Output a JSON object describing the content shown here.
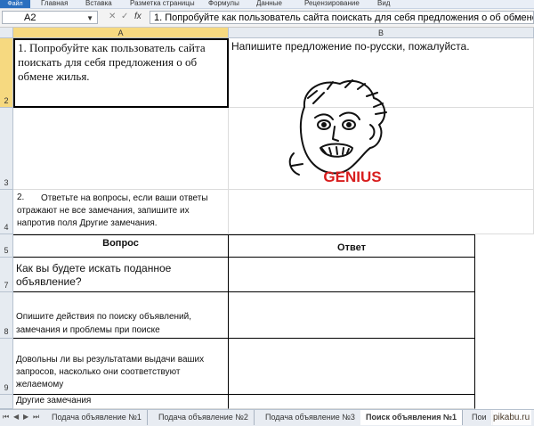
{
  "ribbon": {
    "file": "Файл",
    "tabs": [
      "Главная",
      "Вставка",
      "Разметка страницы",
      "Формулы",
      "Данные",
      "Рецензирование",
      "Вид"
    ]
  },
  "formula_bar": {
    "name_box": "A2",
    "fx": "fx",
    "value": "1. Попробуйте как пользователь сайта поискать для себя предложения о об обмене жилья."
  },
  "columns": [
    "A",
    "B"
  ],
  "rows": [
    "2",
    "3",
    "4",
    "5",
    "7",
    "8",
    "9"
  ],
  "cells": {
    "a2": "1. Попробуйте как пользователь сайта поискать для себя предложения о об обмене жилья.",
    "b2": "Напишите предложение по-русски, пожалуйста.",
    "a4_num": "2.",
    "a4": "Ответьте на вопросы, если ваши ответы отражают не все замечания, запишите их напротив поля Другие замечания.",
    "a5": "Вопрос",
    "b5": "Ответ",
    "a7": "Как вы будете искать поданное объявление?",
    "a8": "Опишите действия по поиску объявлений, замечания и проблемы при поиске",
    "a9": "Довольны ли вы результатами выдачи ваших запросов, насколько они соответствуют желаемому",
    "a10": "Другие замечания"
  },
  "meme_caption": "GENIUS",
  "sheet_tabs": [
    "Подача объявление №1",
    "Подача объявление №2",
    "Подача объявление №3",
    "Поиск объявления №1",
    "Пои"
  ],
  "watermark": "pikabu.ru"
}
